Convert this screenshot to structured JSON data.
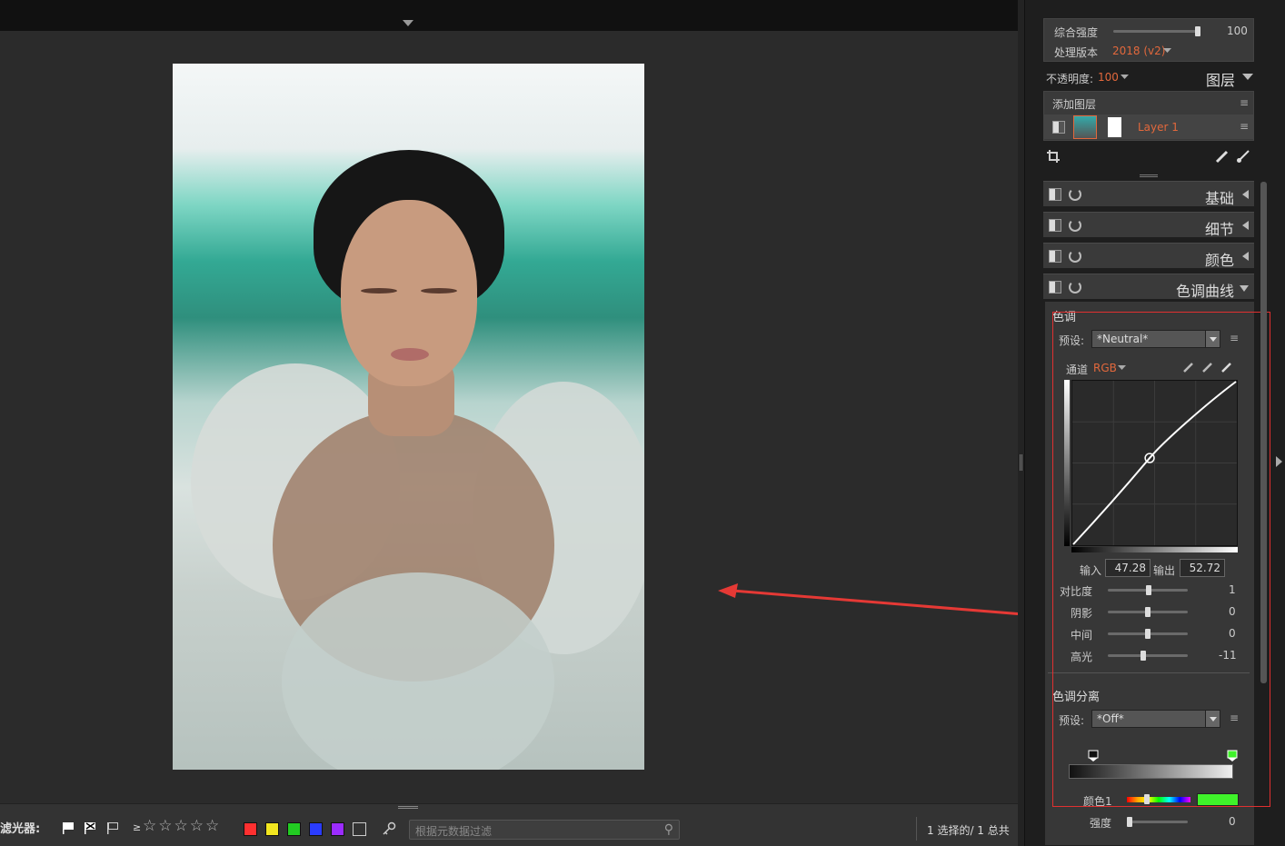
{
  "bottom": {
    "filter_label": "滤光器:",
    "geq": "≥",
    "stars": "☆☆☆☆☆",
    "search_placeholder": "根据元数据过滤",
    "selection": "1 选择的/ 1 总共",
    "color_labels": [
      "#ff3030",
      "#f2e620",
      "#22cc22",
      "#2a3cff",
      "#9b2cff"
    ]
  },
  "panel": {
    "strength_label": "综合强度",
    "strength_value": "100",
    "strength_fraction": 1.0,
    "process_label": "处理版本",
    "process_value": "2018 (v2)",
    "opacity_label": "不透明度:",
    "opacity_value": "100",
    "layers_label": "图层",
    "add_layer": "添加图层",
    "layer_name": "Layer 1"
  },
  "sections": [
    {
      "label": "基础"
    },
    {
      "label": "细节"
    },
    {
      "label": "颜色"
    },
    {
      "label": "色调曲线"
    }
  ],
  "tone": {
    "title": "色调",
    "preset_label": "预设:",
    "preset_value": "*Neutral*",
    "channel_label": "通道",
    "channel_value": "RGB",
    "input_label": "输入",
    "input_value": "47.28",
    "output_label": "输出",
    "output_value": "52.72",
    "sliders": [
      {
        "label": "对比度",
        "value": "1",
        "fraction": 0.51
      },
      {
        "label": "阴影",
        "value": "0",
        "fraction": 0.5
      },
      {
        "label": "中间",
        "value": "0",
        "fraction": 0.5
      },
      {
        "label": "高光",
        "value": "-11",
        "fraction": 0.44
      }
    ]
  },
  "split": {
    "title": "色调分离",
    "preset_label": "预设:",
    "preset_value": "*Off*",
    "color1_label": "颜色1",
    "strength_label": "强度",
    "strength_value": "0",
    "color1_swatch": "#3ff22a"
  }
}
